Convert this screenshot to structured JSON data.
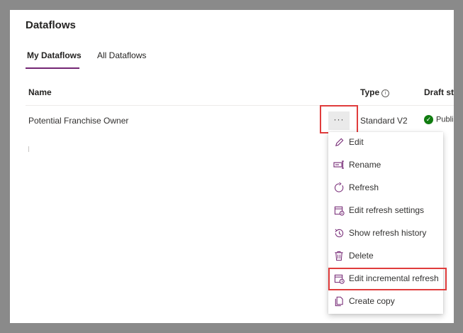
{
  "page": {
    "title": "Dataflows"
  },
  "tabs": [
    {
      "label": "My Dataflows",
      "active": true
    },
    {
      "label": "All Dataflows",
      "active": false
    }
  ],
  "table": {
    "columns": [
      "Name",
      "Type",
      "Draft sta"
    ],
    "rows": [
      {
        "name": "Potential Franchise Owner",
        "type": "Standard V2",
        "draft_status": "Publi"
      }
    ],
    "more_label": "···"
  },
  "context_menu": {
    "items": [
      {
        "label": "Edit",
        "icon": "pencil-icon"
      },
      {
        "label": "Rename",
        "icon": "rename-icon"
      },
      {
        "label": "Refresh",
        "icon": "refresh-icon"
      },
      {
        "label": "Edit refresh settings",
        "icon": "calendar-settings-icon"
      },
      {
        "label": "Show refresh history",
        "icon": "history-icon"
      },
      {
        "label": "Delete",
        "icon": "trash-icon"
      },
      {
        "label": "Edit incremental refresh",
        "icon": "calendar-clock-icon",
        "highlighted": true
      },
      {
        "label": "Create copy",
        "icon": "copy-icon"
      }
    ]
  },
  "colors": {
    "accent": "#742774",
    "highlight": "#e03c3c",
    "success": "#107c10"
  }
}
